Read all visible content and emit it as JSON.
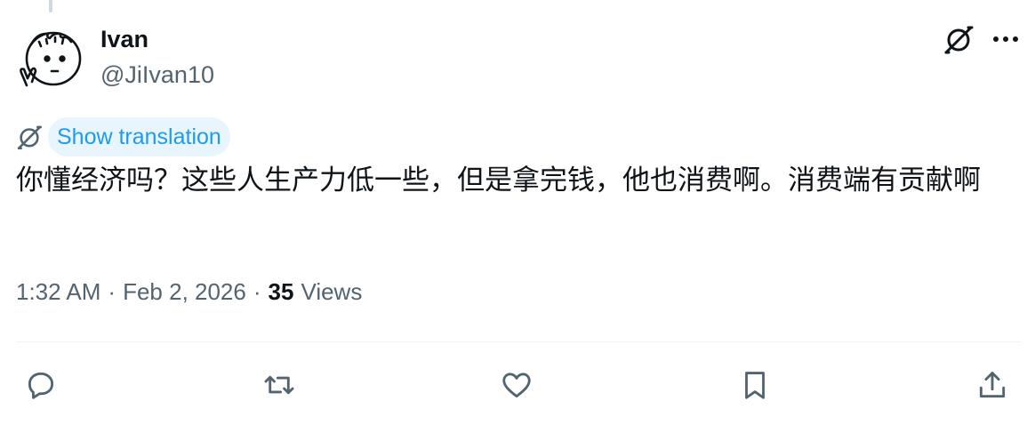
{
  "tweet": {
    "display_name": "Ivan",
    "handle": "@JiIvan10",
    "translate_label": "Show translation",
    "text": "你懂经济吗？这些人生产力低一些，但是拿完钱，他也消费啊。消费端有贡献啊",
    "time": "1:32 AM",
    "separator": "·",
    "date": "Feb 2, 2026",
    "views_count": "35",
    "views_label": "Views"
  },
  "icons": {
    "avatar": "doodle-avatar",
    "translate": "translate-globe-icon",
    "more": "more-icon",
    "reply": "reply-icon",
    "retweet": "retweet-icon",
    "like": "like-icon",
    "bookmark": "bookmark-icon",
    "share": "share-icon"
  },
  "colors": {
    "accent": "#1d9bf0",
    "accent_bg": "#e8f5fd",
    "secondary_text": "#536471",
    "icon": "#536471"
  }
}
